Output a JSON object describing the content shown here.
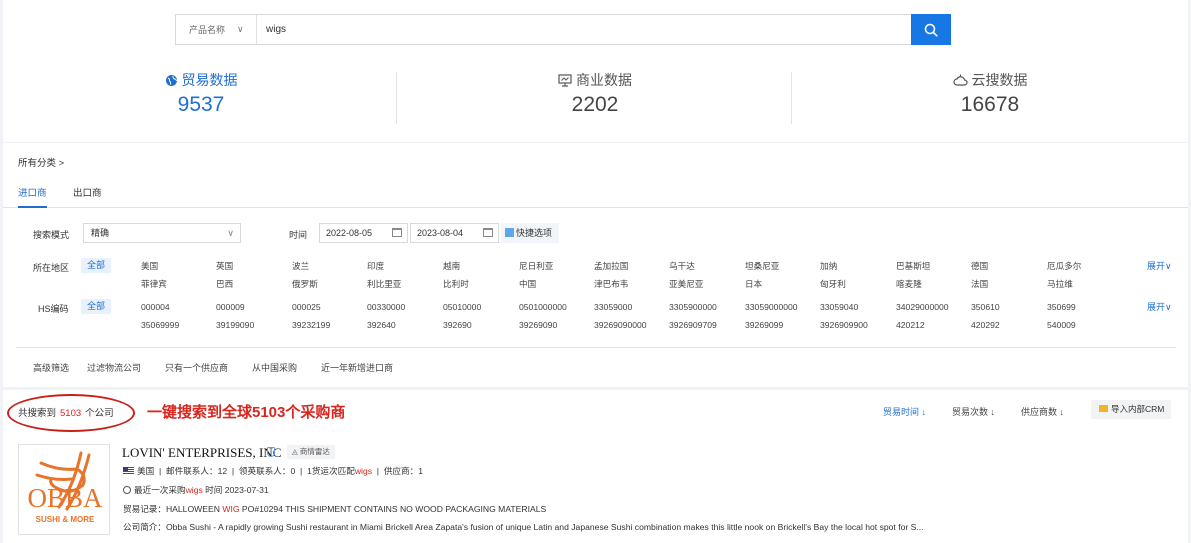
{
  "search": {
    "type_label": "产品名称",
    "query": "wigs"
  },
  "stats": [
    {
      "label": "贸易数据",
      "value": "9537",
      "icon": "globe-icon"
    },
    {
      "label": "商业数据",
      "value": "2202",
      "icon": "monitor-icon"
    },
    {
      "label": "云搜数据",
      "value": "16678",
      "icon": "cloud-icon"
    }
  ],
  "breadcrumb": "所有分类 >",
  "tabs": [
    "进口商",
    "出口商"
  ],
  "filters": {
    "mode_label": "搜索模式",
    "mode_value": "精确",
    "time_label": "时间",
    "date_start": "2022-08-05",
    "date_end": "2023-08-04",
    "quick_label": "快捷选项",
    "region_label": "所在地区",
    "hs_label": "HS编码",
    "all_label": "全部",
    "expand_label": "展开",
    "regions_row1": [
      "美国",
      "英国",
      "波兰",
      "印度",
      "越南",
      "尼日利亚",
      "孟加拉国",
      "乌干达",
      "坦桑尼亚",
      "加纳",
      "巴基斯坦",
      "德国",
      "厄瓜多尔"
    ],
    "regions_row2": [
      "菲律宾",
      "巴西",
      "俄罗斯",
      "利比里亚",
      "比利时",
      "中国",
      "津巴布韦",
      "亚美尼亚",
      "日本",
      "匈牙利",
      "喀麦隆",
      "法国",
      "马拉维"
    ],
    "hs_row1": [
      "000004",
      "000009",
      "000025",
      "00330000",
      "05010000",
      "0501000000",
      "33059000",
      "3305900000",
      "33059000000",
      "33059040",
      "34029000000",
      "350610",
      "350699"
    ],
    "hs_row2": [
      "35069999",
      "39199090",
      "39232199",
      "392640",
      "392690",
      "39269090",
      "39269090000",
      "3926909709",
      "39269099",
      "3926909900",
      "420212",
      "420292",
      "540009"
    ],
    "advanced": [
      "高级筛选",
      "过滤物流公司",
      "只有一个供应商",
      "从中国采购",
      "近一年新增进口商"
    ]
  },
  "results": {
    "count_prefix": "共搜索到",
    "count": "5103",
    "count_suffix": "个公司",
    "promo": "一键搜索到全球5103个采购商",
    "sorts": [
      "贸易时间",
      "贸易次数",
      "供应商数"
    ],
    "crm_label": "导入内部CRM",
    "company": {
      "name": "LOVIN' ENTERPRISES, INC",
      "radar_label": "商情雷达",
      "logo_main": "OBBA",
      "logo_sub": "SUSHI & MORE",
      "country": "美国",
      "mail_contacts": "邮件联系人：12",
      "ly_contacts": "领英联系人：0",
      "match_prefix": "1货运次匹配",
      "match_kw": "wigs",
      "suppliers": "供应商：1",
      "last_prefix": "最近一次采购",
      "last_kw": "wigs",
      "last_time": "时间 2023-07-31",
      "trade_prefix": "贸易记录：HALLOWEEN ",
      "trade_kw": "WIG",
      "trade_rest": " PO#10294 THIS SHIPMENT CONTAINS NO WOOD PACKAGING MATERIALS",
      "intro": "公司简介：Obba Sushi - A rapidly growing Sushi restaurant in Miami Brickell Area Zapata's fusion of unique Latin and Japanese Sushi combination makes this little nook on Brickell's Bay the local hot spot for S..."
    }
  },
  "colors": {
    "accent": "#1f6fd1",
    "highlight": "#d9251d",
    "search_button": "#1677e5"
  }
}
